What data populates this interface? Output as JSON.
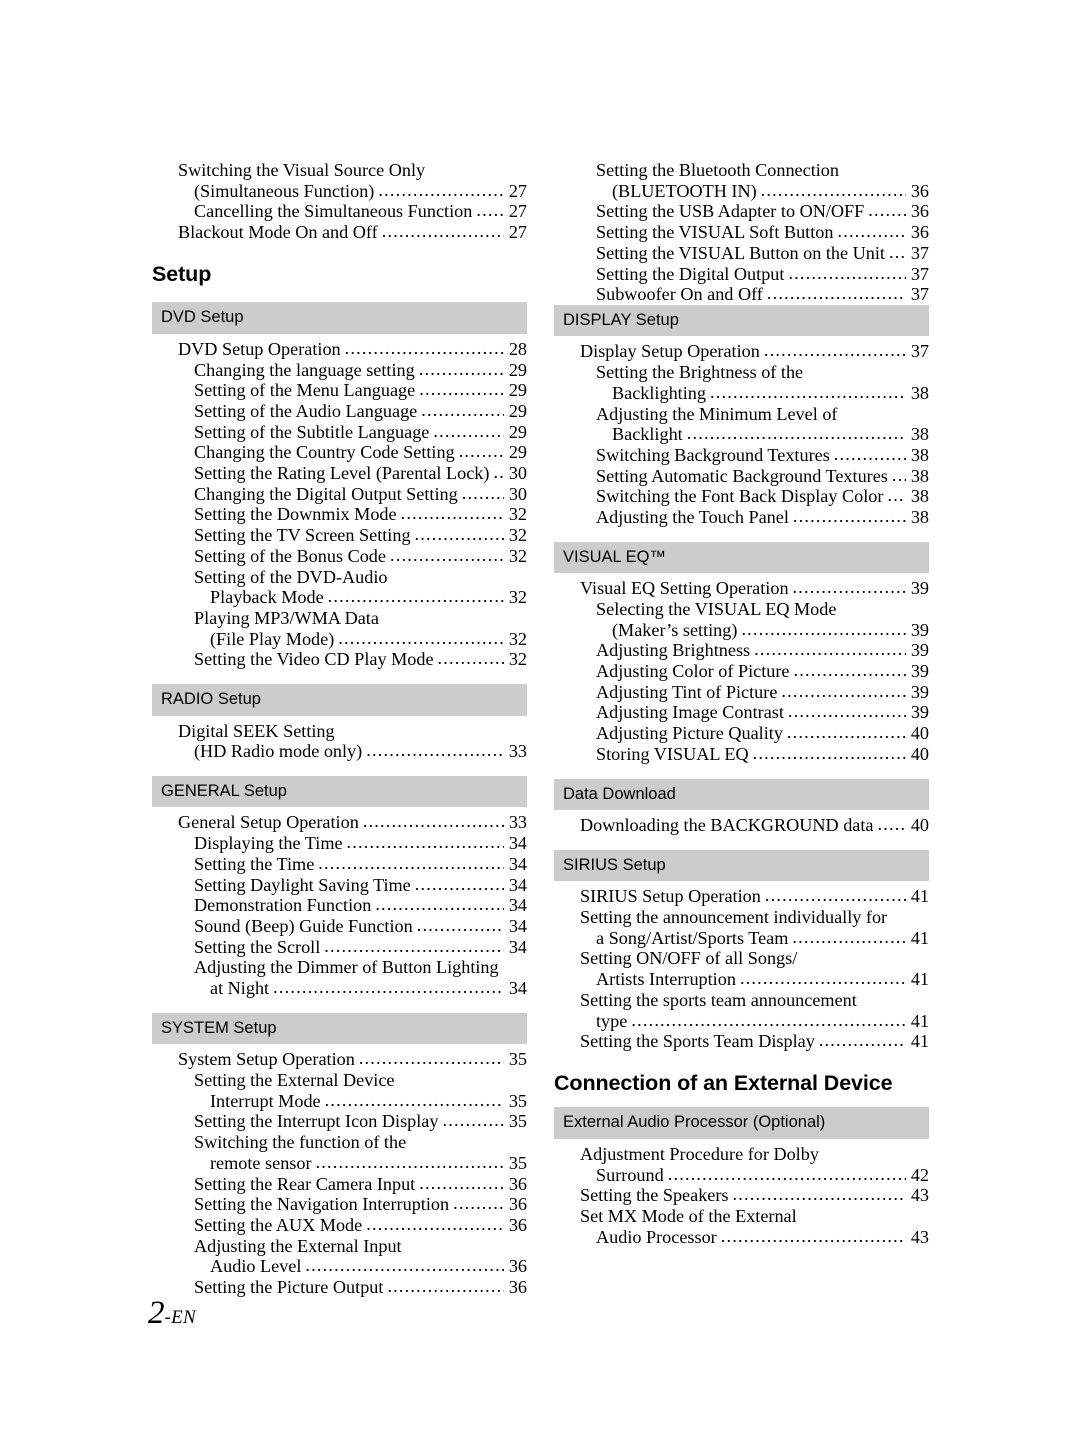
{
  "page": {
    "folio_number": "2",
    "folio_suffix": "-EN",
    "leader": "..........................................................................................................."
  },
  "left_column": {
    "intro_entries": [
      {
        "text": "Switching the Visual Source Only",
        "level": 1,
        "page": ""
      },
      {
        "text": "(Simultaneous Function)",
        "level": 2,
        "page": "27"
      },
      {
        "text": "Cancelling the Simultaneous Function",
        "level": 2,
        "page": "27"
      },
      {
        "text": "Blackout Mode On and Off",
        "level": 1,
        "page": "27"
      }
    ],
    "title": "Setup",
    "sections": [
      {
        "heading": "DVD Setup",
        "entries": [
          {
            "text": "DVD Setup Operation",
            "level": 1,
            "page": "28"
          },
          {
            "text": "Changing the language setting",
            "level": 2,
            "page": "29"
          },
          {
            "text": "Setting of the Menu Language",
            "level": 2,
            "page": "29"
          },
          {
            "text": "Setting of the Audio Language",
            "level": 2,
            "page": "29"
          },
          {
            "text": "Setting of the Subtitle Language",
            "level": 2,
            "page": "29"
          },
          {
            "text": "Changing the Country Code Setting",
            "level": 2,
            "page": "29"
          },
          {
            "text": "Setting the Rating Level (Parental Lock)",
            "level": 2,
            "page": "30"
          },
          {
            "text": "Changing the Digital Output Setting",
            "level": 2,
            "page": "30"
          },
          {
            "text": "Setting the Downmix Mode",
            "level": 2,
            "page": "32"
          },
          {
            "text": "Setting the TV Screen Setting",
            "level": 2,
            "page": "32"
          },
          {
            "text": "Setting of the Bonus Code",
            "level": 2,
            "page": "32"
          },
          {
            "text": "Setting of the DVD-Audio",
            "level": 2,
            "page": ""
          },
          {
            "text": "Playback Mode",
            "level": 3,
            "page": "32"
          },
          {
            "text": "Playing MP3/WMA Data",
            "level": 2,
            "page": ""
          },
          {
            "text": "(File Play Mode)",
            "level": 3,
            "page": "32"
          },
          {
            "text": "Setting the Video CD Play Mode",
            "level": 2,
            "page": "32"
          }
        ]
      },
      {
        "heading": "RADIO Setup",
        "entries": [
          {
            "text": "Digital SEEK Setting",
            "level": 1,
            "page": ""
          },
          {
            "text": "(HD Radio mode only)",
            "level": 2,
            "page": "33"
          }
        ]
      },
      {
        "heading": "GENERAL Setup",
        "entries": [
          {
            "text": "General Setup Operation",
            "level": 1,
            "page": "33"
          },
          {
            "text": "Displaying the Time",
            "level": 2,
            "page": "34"
          },
          {
            "text": "Setting the Time",
            "level": 2,
            "page": "34"
          },
          {
            "text": "Setting Daylight Saving Time",
            "level": 2,
            "page": "34"
          },
          {
            "text": "Demonstration Function",
            "level": 2,
            "page": "34"
          },
          {
            "text": "Sound (Beep) Guide Function",
            "level": 2,
            "page": "34"
          },
          {
            "text": "Setting the Scroll",
            "level": 2,
            "page": "34"
          },
          {
            "text": "Adjusting the Dimmer of Button Lighting",
            "level": 2,
            "page": ""
          },
          {
            "text": "at Night",
            "level": 3,
            "page": "34"
          }
        ]
      },
      {
        "heading": "SYSTEM Setup",
        "entries": [
          {
            "text": "System Setup Operation",
            "level": 1,
            "page": "35"
          },
          {
            "text": "Setting the External Device",
            "level": 2,
            "page": ""
          },
          {
            "text": "Interrupt Mode",
            "level": 3,
            "page": "35"
          },
          {
            "text": "Setting the Interrupt Icon Display",
            "level": 2,
            "page": "35"
          },
          {
            "text": "Switching the function of the",
            "level": 2,
            "page": ""
          },
          {
            "text": "remote sensor",
            "level": 3,
            "page": "35"
          },
          {
            "text": "Setting the Rear Camera Input",
            "level": 2,
            "page": "36"
          },
          {
            "text": "Setting the Navigation Interruption",
            "level": 2,
            "page": "36"
          },
          {
            "text": "Setting the AUX Mode",
            "level": 2,
            "page": "36"
          },
          {
            "text": "Adjusting the External Input",
            "level": 2,
            "page": ""
          },
          {
            "text": "Audio Level",
            "level": 3,
            "page": "36"
          },
          {
            "text": "Setting the Picture Output",
            "level": 2,
            "page": "36"
          }
        ]
      }
    ]
  },
  "right_column": {
    "intro_entries": [
      {
        "text": "Setting the Bluetooth Connection",
        "level": 2,
        "page": ""
      },
      {
        "text": "(BLUETOOTH IN)",
        "level": 3,
        "page": "36"
      },
      {
        "text": "Setting the USB Adapter to ON/OFF",
        "level": 2,
        "page": "36"
      },
      {
        "text": "Setting the VISUAL Soft Button",
        "level": 2,
        "page": "36"
      },
      {
        "text": "Setting the VISUAL Button on the Unit",
        "level": 2,
        "page": "37"
      },
      {
        "text": "Setting the Digital Output",
        "level": 2,
        "page": "37"
      },
      {
        "text": "Subwoofer On and Off",
        "level": 2,
        "page": "37"
      }
    ],
    "sections": [
      {
        "heading": "DISPLAY Setup",
        "entries": [
          {
            "text": "Display Setup Operation",
            "level": 1,
            "page": "37"
          },
          {
            "text": "Setting the Brightness of the",
            "level": 2,
            "page": ""
          },
          {
            "text": "Backlighting",
            "level": 3,
            "page": "38"
          },
          {
            "text": "Adjusting the Minimum Level of",
            "level": 2,
            "page": ""
          },
          {
            "text": "Backlight",
            "level": 3,
            "page": "38"
          },
          {
            "text": "Switching Background Textures",
            "level": 2,
            "page": "38"
          },
          {
            "text": "Setting Automatic Background Textures",
            "level": 2,
            "page": "38"
          },
          {
            "text": "Switching the Font Back Display Color",
            "level": 2,
            "page": "38"
          },
          {
            "text": "Adjusting the Touch Panel",
            "level": 2,
            "page": "38"
          }
        ]
      },
      {
        "heading": "VISUAL EQ™",
        "entries": [
          {
            "text": "Visual EQ Setting Operation",
            "level": 1,
            "page": "39"
          },
          {
            "text": "Selecting the VISUAL EQ Mode",
            "level": 2,
            "page": ""
          },
          {
            "text": "(Maker’s setting)",
            "level": 3,
            "page": "39"
          },
          {
            "text": "Adjusting Brightness",
            "level": 2,
            "page": "39"
          },
          {
            "text": "Adjusting Color of Picture",
            "level": 2,
            "page": "39"
          },
          {
            "text": "Adjusting Tint of Picture",
            "level": 2,
            "page": "39"
          },
          {
            "text": "Adjusting Image Contrast",
            "level": 2,
            "page": "39"
          },
          {
            "text": "Adjusting Picture Quality",
            "level": 2,
            "page": "40"
          },
          {
            "text": "Storing VISUAL EQ",
            "level": 2,
            "page": "40"
          }
        ]
      },
      {
        "heading": "Data Download",
        "entries": [
          {
            "text": "Downloading the BACKGROUND data",
            "level": 1,
            "page": "40"
          }
        ]
      },
      {
        "heading": "SIRIUS Setup",
        "entries": [
          {
            "text": "SIRIUS Setup Operation",
            "level": 1,
            "page": "41"
          },
          {
            "text": "Setting the announcement individually for",
            "level": 1,
            "page": ""
          },
          {
            "text": "a Song/Artist/Sports Team",
            "level": 2,
            "page": "41"
          },
          {
            "text": "Setting ON/OFF of all Songs/",
            "level": 1,
            "page": ""
          },
          {
            "text": "Artists Interruption",
            "level": 2,
            "page": "41"
          },
          {
            "text": "Setting the sports team announcement",
            "level": 1,
            "page": ""
          },
          {
            "text": "type",
            "level": 2,
            "page": "41"
          },
          {
            "text": "Setting the Sports Team Display",
            "level": 1,
            "page": "41"
          }
        ]
      }
    ],
    "title": "Connection of an External Device",
    "sections_after_title": [
      {
        "heading": "External Audio Processor (Optional)",
        "entries": [
          {
            "text": "Adjustment Procedure for Dolby",
            "level": 1,
            "page": ""
          },
          {
            "text": "Surround",
            "level": 2,
            "page": "42"
          },
          {
            "text": "Setting the Speakers",
            "level": 1,
            "page": "43"
          },
          {
            "text": "Set MX Mode of the External",
            "level": 1,
            "page": ""
          },
          {
            "text": "Audio Processor",
            "level": 2,
            "page": "43"
          }
        ]
      }
    ]
  }
}
